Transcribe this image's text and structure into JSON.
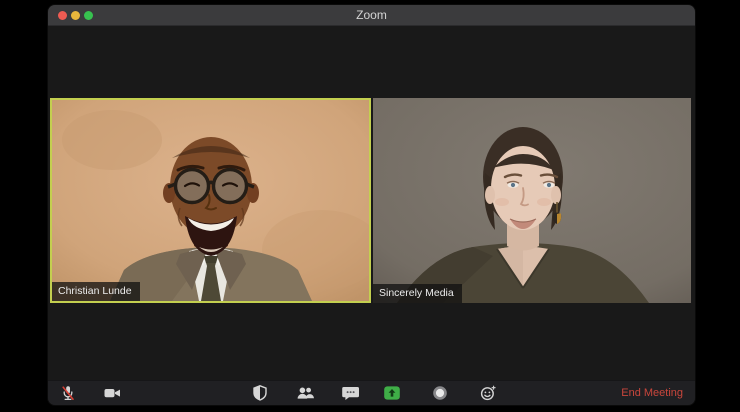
{
  "window": {
    "title": "Zoom",
    "traffic_lights": {
      "close": "close",
      "minimize": "minimize",
      "maximize": "zoom"
    }
  },
  "meeting": {
    "participants": [
      {
        "name": "Christian Lunde",
        "active_speaker": true
      },
      {
        "name": "Sincerely Media",
        "active_speaker": false
      }
    ]
  },
  "toolbar": {
    "icons": [
      "mic-muted-icon",
      "camera-icon",
      "shield-icon",
      "participants-icon",
      "chat-icon",
      "share-screen-icon",
      "record-icon",
      "reactions-icon"
    ],
    "end_meeting_label": "End Meeting"
  },
  "colors": {
    "active_speaker_border": "#c3cf4f",
    "share_screen_green": "#3fae47",
    "mute_slash_red": "#d94136",
    "end_meeting_red": "#c9463c"
  }
}
